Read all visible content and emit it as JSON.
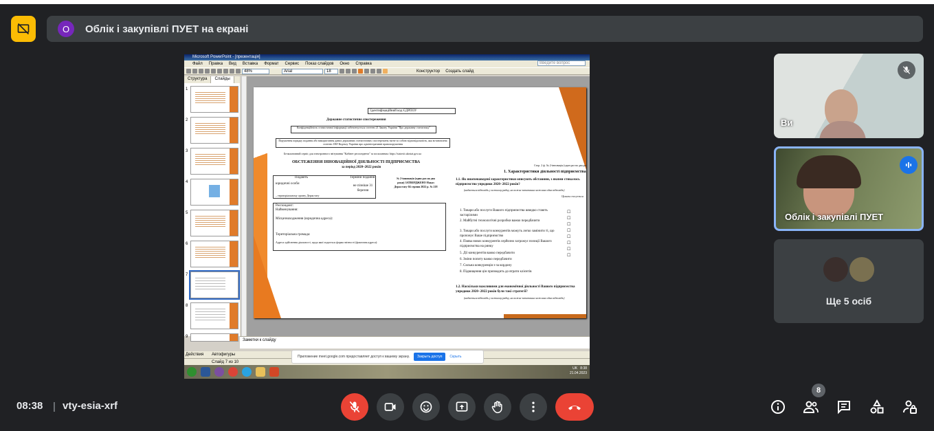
{
  "header": {
    "presenter_avatar_letter": "O",
    "presenting_text": "Облік і закупівлі ПУЕТ на екрані"
  },
  "shared_screen": {
    "window_title": "Microsoft PowerPoint - [презентація]",
    "menu": [
      "Файл",
      "Правка",
      "Вид",
      "Вставка",
      "Формат",
      "Сервис",
      "Показ слайдов",
      "Окно",
      "Справка"
    ],
    "zoom": "48%",
    "font_name": "Arial",
    "font_size": "18",
    "search_placeholder": "Введите вопрос",
    "designer_label": "Конструктор",
    "new_slide_label": "Создать слайд",
    "tabs": [
      "Структура",
      "Слайды"
    ],
    "slide_numbers": [
      "1",
      "2",
      "3",
      "4",
      "5",
      "6",
      "7",
      "8",
      "9"
    ],
    "doc": {
      "id_code": "Ідентифікаційний код ЄДРПОУ",
      "obs": "Державне статистичне спостереження",
      "conf": "Конфіденційність статистичної інформації забезпечується статтею 21 Закону України \"Про державну статистику\"",
      "viol": "Порушення порядку подання або використання даних державних статистичних спостережень тягне за собою відповідальність, яка встановлена статтею 186³ Кодексу України про адміністративні правопорушення",
      "service": "Безкоштовний сервіс для електронного звітування \"Кабінет респондента\" за посиланням: https://statzvit.ukrstat.gov.ua",
      "title": "ОБСТЕЖЕННЯ ІННОВАЦІЙНОЇ ДІЯЛЬНОСТІ ПІДПРИЄМСТВА",
      "period": "за період 2020–2022 років",
      "form_no": "№ 2-інновація (один раз на два роки) ЗАТВЕРДЖЕНО Наказ Держстату 04 серпня 2022 р. № 218",
      "submit": "Подають",
      "deadline": "Терміни подання",
      "legal": "юридичні особи",
      "deadline_val": "не пізніше 31 березня",
      "organ": "– територіальному органу Держстату",
      "respondent": "Респондент:",
      "name_field": "Найменування:",
      "location": "Місцезнаходження (юридична адреса):",
      "territory": "Територіальна громада:",
      "address": "Адреса здійснення діяльності, щодо якої подається форма звітності (фактична адреса):",
      "page_hint": "Стор. 2 ф. № 2-інновація (один раз на два роки)",
      "section1": "1. Характеристики діяльності підприємства",
      "q11": "1.1. Як нижченаведені характеристики описують обставини, з якими стикалось підприємство упродовж 2020−2022 років?",
      "q11_hint": "(надається відповідь у кожному рядку, на кожне запитання можлива одна відповідь)",
      "col": "Цілком стосується",
      "items": [
        "1. Товари або послуги Вашого підприємства швидко стають застарілими",
        "2. Майбутні технологічні розробки важко передбачити",
        "3. Товари або послуги конкурентів можуть легко замінити ті, що пропонує Ваше підприємство",
        "4. Поява нових конкурентів серйозно загрожує позиції Вашого підприємства на ринку",
        "5. Дії конкурентів важко передбачити",
        "6. Зміни попиту важко передбачити",
        "7. Сильна конкуренція з-за кордону",
        "8. Підвищення цін призводить до втрати клієнтів"
      ],
      "q12": "1.2. Наскільки важливими для економічної діяльності Вашого підприємства упродовж 2020−2022 років були такі стратегії?",
      "q12_hint": "(надається відповідь у кожному рядку, на кожне запитання можлива одна відповідь)"
    },
    "notes_placeholder": "Заметки к слайду",
    "draw_label": "Действия",
    "autoshapes_label": "Автофигуры",
    "slide_status": "Слайд 7 из 10",
    "share_notice": "Приложение meet.google.com предоставляет доступ к вашему экрану.",
    "share_stop": "Закрыть доступ",
    "share_hide": "Скрыть",
    "tray_lang": "UK",
    "tray_time": "8:38",
    "tray_date": "21.04.2023"
  },
  "participants": {
    "tile1_name": "Ви",
    "tile2_name": "Облік і закупівлі ПУЕТ",
    "more_label": "Ще 5 осіб"
  },
  "footer": {
    "time": "08:38",
    "separator": "|",
    "meeting_code": "vty-esia-xrf",
    "people_count": "8"
  },
  "colors": {
    "background": "#202124",
    "accent_yellow": "#fbbc04",
    "danger_red": "#ea4335",
    "active_blue": "#1a73e8"
  }
}
